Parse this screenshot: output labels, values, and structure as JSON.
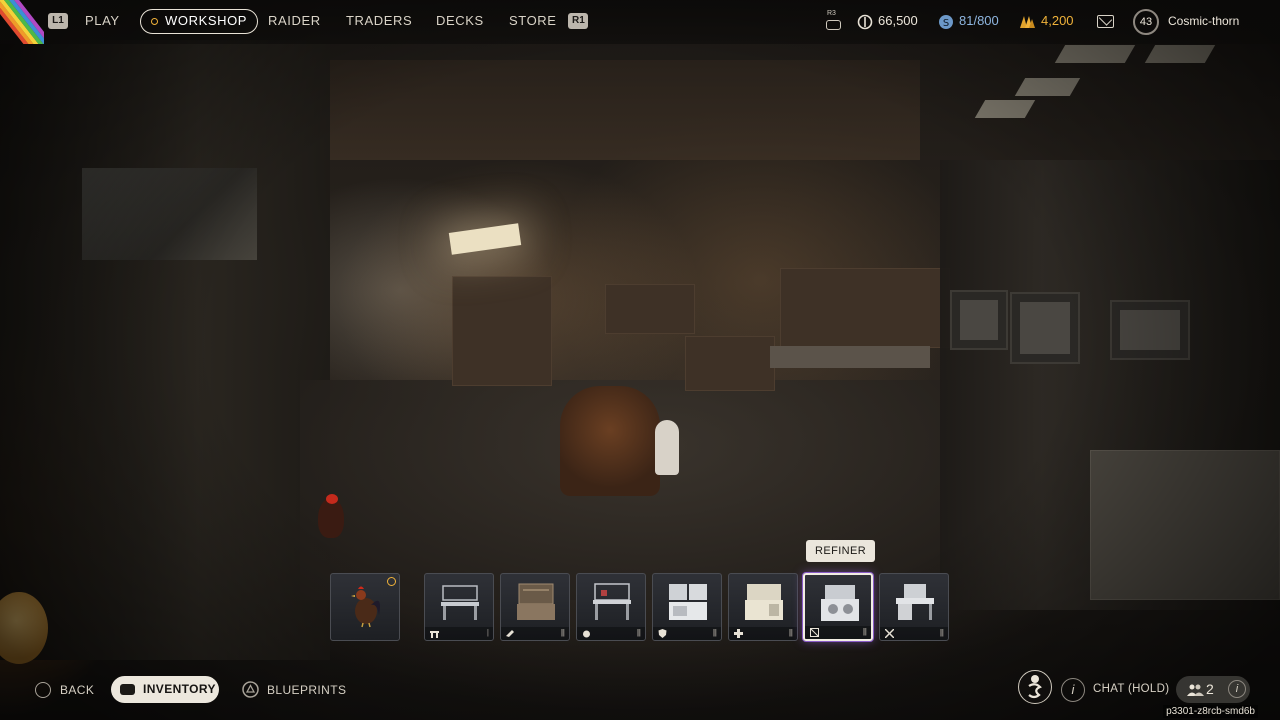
{
  "nav": {
    "left_shoulder": "L1",
    "right_shoulder": "R1",
    "items": [
      {
        "label": "PLAY"
      },
      {
        "label": "WORKSHOP",
        "active": true
      },
      {
        "label": "RAIDER"
      },
      {
        "label": "TRADERS"
      },
      {
        "label": "DECKS"
      },
      {
        "label": "STORE"
      }
    ]
  },
  "stats": {
    "r3_label": "R3",
    "currency": "66,500",
    "capacity": "81/800",
    "credits": "4,200",
    "level": "43",
    "username": "Cosmic-thorn"
  },
  "colors": {
    "accent": "#f0b23a",
    "capacity_blue": "#8fb6e0",
    "selected_glow": "#8a5cc8",
    "stripes": [
      "#e04a2f",
      "#f09a2a",
      "#f4d23a",
      "#4cb84a",
      "#3b8fd6",
      "#b049c4"
    ]
  },
  "tooltip": "REFINER",
  "hotbar": {
    "slots": [
      {
        "icon": "rooster-icon",
        "kind": "pet"
      },
      {
        "icon": "workbench-icon",
        "category": "bench-icon"
      },
      {
        "icon": "workbench-icon",
        "category": "gunsmith-icon"
      },
      {
        "icon": "workbench-icon",
        "category": "gear-bench-icon"
      },
      {
        "icon": "workbench-icon",
        "category": "shield-icon"
      },
      {
        "icon": "workbench-icon",
        "category": "medical-icon"
      },
      {
        "icon": "refiner-icon",
        "category": "refiner-icon",
        "selected": true
      },
      {
        "icon": "workbench-icon",
        "category": "crossed-tools-icon"
      }
    ]
  },
  "bottom": {
    "back": "BACK",
    "inventory": "INVENTORY",
    "blueprints": "BLUEPRINTS",
    "chat": "CHAT (HOLD)",
    "party_count": "2",
    "session_id": "p3301-z8rcb-smd6b"
  }
}
